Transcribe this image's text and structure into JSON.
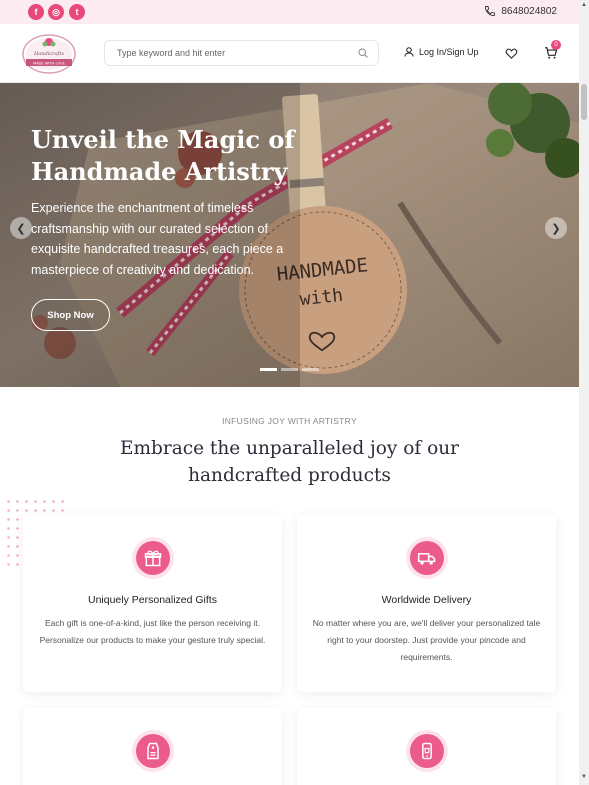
{
  "topbar": {
    "social": [
      {
        "name": "facebook-icon",
        "glyph": "f"
      },
      {
        "name": "instagram-icon",
        "glyph": "◎"
      },
      {
        "name": "twitter-icon",
        "glyph": "t"
      }
    ],
    "phone": "8648024802"
  },
  "header": {
    "logo_text": "Handicrafts",
    "logo_tagline": "MADE WITH LOVE",
    "search_placeholder": "Type keyword and hit enter",
    "login_label": "Log In/Sign Up",
    "cart_count": "0"
  },
  "hero": {
    "title": "Unveil the Magic of Handmade Artistry",
    "text": "Experience the enchantment of timeless craftsmanship with our curated selection of exquisite handcrafted treasures, each piece a masterpiece of creativity and dedication.",
    "button": "Shop Now",
    "tag_line1": "HANDMADE",
    "tag_line2": "with",
    "prev_glyph": "❮",
    "next_glyph": "❯"
  },
  "section": {
    "eyebrow": "INFUSING JOY WITH ARTISTRY",
    "title_line1": "Embrace the unparalleled joy of our",
    "title_line2": "handcrafted products",
    "cards": [
      {
        "icon": "gift-icon",
        "title": "Uniquely Personalized Gifts",
        "text": "Each gift is one-of-a-kind, just like the person receiving it. Personalize our products to make your gesture truly special."
      },
      {
        "icon": "delivery-truck-icon",
        "title": "Worldwide Delivery",
        "text": "No matter where you are, we'll deliver your personalized tale right to your doorstep. Just provide your pincode and requirements."
      },
      {
        "icon": "price-tag-icon",
        "title": "",
        "text": ""
      },
      {
        "icon": "mobile-shop-icon",
        "title": "",
        "text": ""
      }
    ]
  },
  "colors": {
    "accent": "#e8497b",
    "accent_light": "#fde3ec",
    "topbar_bg": "#fcebf1"
  }
}
